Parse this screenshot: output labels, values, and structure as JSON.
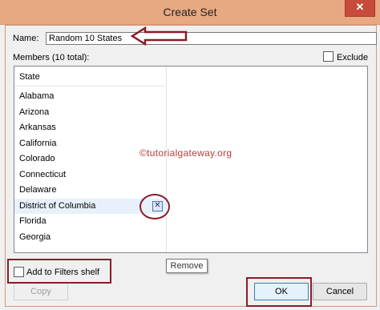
{
  "window": {
    "title": "Create Set",
    "close_glyph": "✕"
  },
  "name_field": {
    "label": "Name:",
    "value": "Random 10 States"
  },
  "members": {
    "label": "Members (10 total):",
    "exclude_label": "Exclude",
    "exclude_checked": false
  },
  "list": {
    "column_header": "State",
    "rows": [
      "Alabama",
      "Arizona",
      "Arkansas",
      "California",
      "Colorado",
      "Connecticut",
      "Delaware",
      "District of Columbia",
      "Florida",
      "Georgia"
    ],
    "hovered_row": "District of Columbia",
    "remove_glyph": "✕",
    "tooltip": "Remove"
  },
  "watermark": "©tutorialgateway.org",
  "add_filters": {
    "label": "Add to Filters shelf",
    "checked": false
  },
  "buttons": {
    "copy": "Copy",
    "ok": "OK",
    "cancel": "Cancel"
  },
  "colors": {
    "titlebar": "#e8a882",
    "close": "#c74a3a",
    "annotation": "#8b1b2b",
    "watermark": "#b83a3a"
  }
}
